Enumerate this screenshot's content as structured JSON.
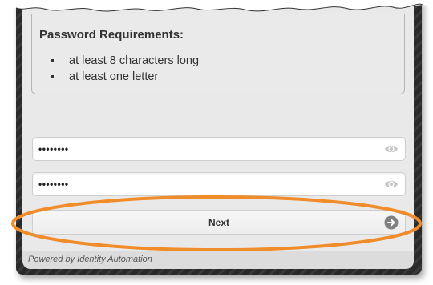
{
  "requirements": {
    "title": "Password Requirements:",
    "items": [
      {
        "text": "at least 8 characters long"
      },
      {
        "text": "at least one letter"
      }
    ]
  },
  "fields": {
    "password_value": "••••••••",
    "confirm_value": "••••••••"
  },
  "actions": {
    "next_label": "Next"
  },
  "footer": {
    "text": "Powered by Identity Automation"
  },
  "colors": {
    "highlight": "#f08c2a",
    "panel": "#e9e9e9",
    "frame": "#2f2f2f"
  },
  "icons": {
    "field_icon": "eye-icon",
    "next_icon": "arrow-right-circle-icon"
  }
}
